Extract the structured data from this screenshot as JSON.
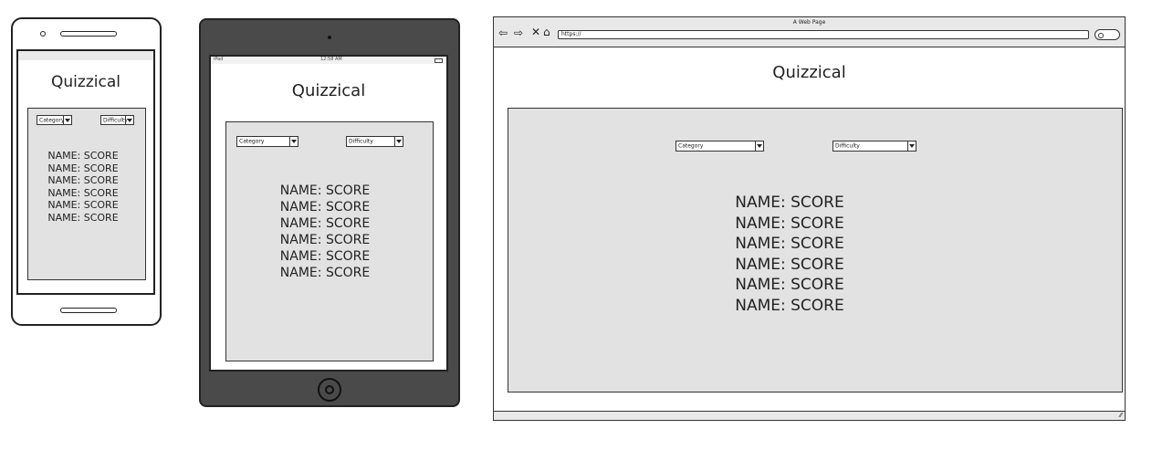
{
  "app_title": "Quizzical",
  "filters": {
    "category": "Category",
    "difficulty": "Difficulty"
  },
  "score_rows": [
    "NAME: SCORE",
    "NAME: SCORE",
    "NAME: SCORE",
    "NAME: SCORE",
    "NAME: SCORE",
    "NAME: SCORE"
  ],
  "tablet_status": {
    "device": "iPad",
    "time": "12:58 AM"
  },
  "browser": {
    "window_title": "A Web Page",
    "url": "https://"
  },
  "colors": {
    "panel_bg": "#e2e2e2",
    "tablet_frame": "#4a4a4a",
    "browser_chrome": "#e8e8e8"
  }
}
